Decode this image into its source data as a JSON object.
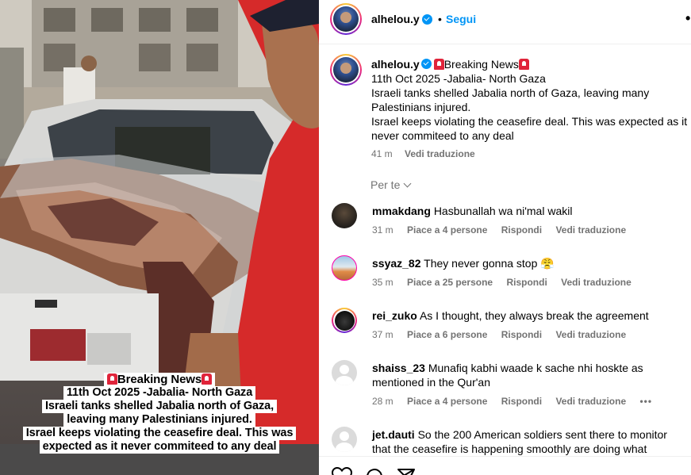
{
  "post": {
    "author": "alhelou.y",
    "follow_label": "Segui",
    "separator": "•",
    "more_label": "•",
    "caption": {
      "author": "alhelou.y",
      "headline": "Breaking News",
      "line1": "11th Oct 2025 -Jabalia- North Gaza",
      "line2": "Israeli tanks shelled Jabalia north of Gaza, leaving many Palestinians injured.",
      "line3": "Israel keeps violating the ceasefire deal. This was expected as it never commiteed to any deal",
      "time": "41 m",
      "translate_label": "Vedi traduzione"
    },
    "for_you_label": "Per te"
  },
  "media_caption": {
    "headline": "Breaking News",
    "line1": "11th Oct 2025 -Jabalia- North Gaza",
    "line2": "Israeli tanks shelled Jabalia north of Gaza,",
    "line3": "leaving many Palestinians injured.",
    "line4": "Israel keeps violating the ceasefire deal. This was",
    "line5": "expected as it never commiteed to any deal"
  },
  "comments": [
    {
      "user": "mmakdang",
      "text": "Hasbunallah wa ni'mal wakil",
      "time": "31 m",
      "likes": "Piace a 4 persone",
      "reply": "Rispondi",
      "translate": "Vedi traduzione"
    },
    {
      "user": "ssyaz_82",
      "text": "They never gonna stop 😤",
      "time": "35 m",
      "likes": "Piace a 25 persone",
      "reply": "Rispondi",
      "translate": "Vedi traduzione"
    },
    {
      "user": "rei_zuko",
      "text": "As I thought, they always break the agreement",
      "time": "37 m",
      "likes": "Piace a 6 persone",
      "reply": "Rispondi",
      "translate": "Vedi traduzione"
    },
    {
      "user": "shaiss_23",
      "text": "Munafiq kabhi waade k sache nhi hoskte as mentioned in the Qur'an",
      "time": "28 m",
      "likes": "Piace a 4 persone",
      "reply": "Rispondi",
      "translate": "Vedi traduzione",
      "more": "•••"
    },
    {
      "user": "jet.dauti",
      "text": "So the 200 American soldiers sent there to monitor that the ceasefire is happening smoothly are doing what"
    }
  ],
  "icons": {
    "like": "heart-icon",
    "comment": "comment-icon",
    "share": "share-icon",
    "verified": "verified-badge-icon",
    "siren": "siren-emoji-icon"
  },
  "colors": {
    "accent": "#0095f6",
    "muted": "#737373",
    "divider": "#efefef"
  }
}
